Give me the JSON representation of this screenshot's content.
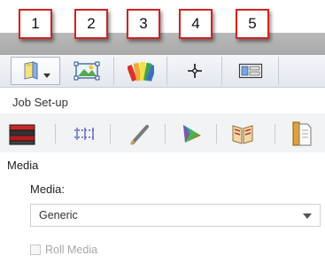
{
  "callouts": [
    "1",
    "2",
    "3",
    "4",
    "5"
  ],
  "toolbar": {
    "buttons": [
      {
        "icon": "book-icon",
        "has_dropdown": true
      },
      {
        "icon": "image-edit-icon"
      },
      {
        "icon": "color-swatches-icon"
      },
      {
        "icon": "crosshair-icon"
      },
      {
        "icon": "layout-window-icon"
      }
    ]
  },
  "section": {
    "label": "Job Set-up"
  },
  "subtabs": [
    {
      "icon": "media-stack-icon",
      "active": true
    },
    {
      "icon": "grid-dots-icon"
    },
    {
      "icon": "pen-icon"
    },
    {
      "icon": "color-gamut-icon"
    },
    {
      "icon": "book-open-icon"
    },
    {
      "icon": "document-icon"
    }
  ],
  "media": {
    "header": "Media",
    "label": "Media:",
    "selected": "Generic",
    "roll_media_label": "Roll Media",
    "roll_media_checked": false
  },
  "colors": {
    "callout_border": "#d2231f",
    "band": "#b0b0b0"
  }
}
